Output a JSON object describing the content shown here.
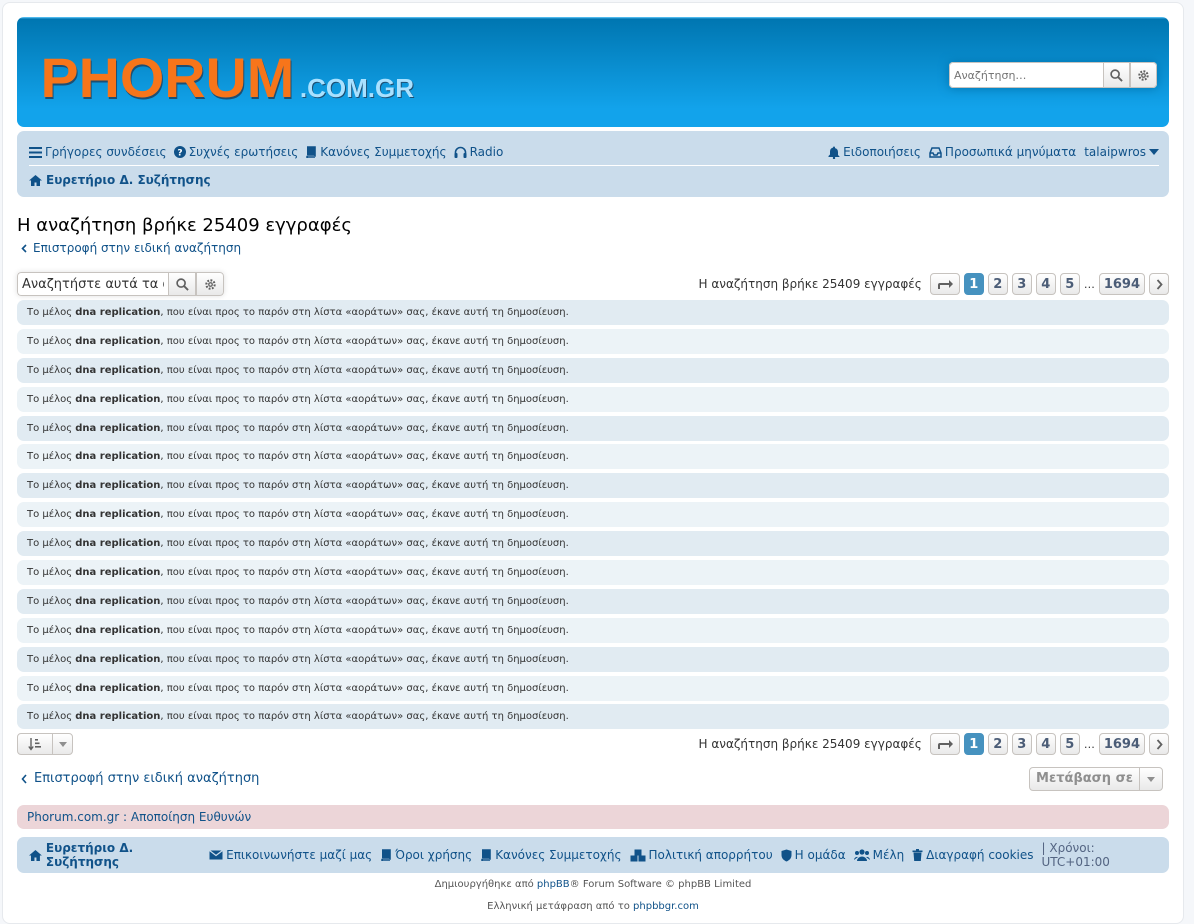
{
  "header": {
    "logo_main": "PHORUM",
    "logo_sub": ".COM.GR",
    "search_placeholder": "Αναζήτηση…"
  },
  "navbar": {
    "links_left": [
      {
        "label": "Γρήγορες συνδέσεις",
        "icon": "bars-icon"
      },
      {
        "label": "Συχνές ερωτήσεις",
        "icon": "question-circle-icon"
      },
      {
        "label": "Κανόνες Συμμετοχής",
        "icon": "book-icon"
      },
      {
        "label": "Radio",
        "icon": "headphones-icon"
      }
    ],
    "notifications": "Ειδοποιήσεις",
    "private_messages": "Προσωπικά μηνύματα",
    "username": "talaipwros",
    "breadcrumb": "Ευρετήριο Δ. Συζήτησης"
  },
  "page": {
    "title": "Η αναζήτηση βρήκε 25409 εγγραφές",
    "back_link": "Επιστροφή στην ειδική αναζήτηση",
    "search_value": "Αναζητήστε αυτά τα απ",
    "result_count": "Η αναζήτηση βρήκε 25409 εγγραφές",
    "pages": [
      "1",
      "2",
      "3",
      "4",
      "5"
    ],
    "ellipsis": "…",
    "last_page": "1694",
    "active_page": "1"
  },
  "rows": {
    "prefix": "Το μέλος",
    "member": "dna replication",
    "suffix": ", που είναι προς το παρόν στη λίστα «αοράτων» σας, έκανε αυτή τη δημοσίευση.",
    "count": 15
  },
  "bottom": {
    "back_link": "Επιστροφή στην ειδική αναζήτηση",
    "jump_to": "Μετάβαση σε"
  },
  "notice": {
    "text": "Phorum.com.gr : Αποποίηση Ευθυνών"
  },
  "footer": {
    "index": "Ευρετήριο Δ. Συζήτησης",
    "links": [
      {
        "label": "Επικοινωνήστε μαζί μας",
        "icon": "envelope-icon"
      },
      {
        "label": "Όροι χρήσης",
        "icon": "book-icon"
      },
      {
        "label": "Κανόνες Συμμετοχής",
        "icon": "book-icon"
      },
      {
        "label": "Πολιτική απορρήτου",
        "icon": "cubes-icon"
      },
      {
        "label": "Η ομάδα",
        "icon": "shield-icon"
      },
      {
        "label": "Μέλη",
        "icon": "users-icon"
      },
      {
        "label": "Διαγραφή cookies",
        "icon": "trash-icon"
      }
    ],
    "timezone": "| Χρόνοι: UTC+01:00",
    "credit_prefix": "Δημιουργήθηκε από ",
    "credit_link": "phpBB",
    "credit_suffix": "® Forum Software © phpBB Limited",
    "translation_prefix": "Ελληνική μετάφραση από το ",
    "translation_link": "phpbbgr.com"
  },
  "colors": {
    "link": "#105289",
    "navbar_bg": "#cadceb",
    "row_odd": "#e1ebf2",
    "row_even": "#ecf3f7",
    "active_page": "#4692bf",
    "logo_orange": "#f7751a",
    "notice_bg": "#ecd5d8"
  }
}
